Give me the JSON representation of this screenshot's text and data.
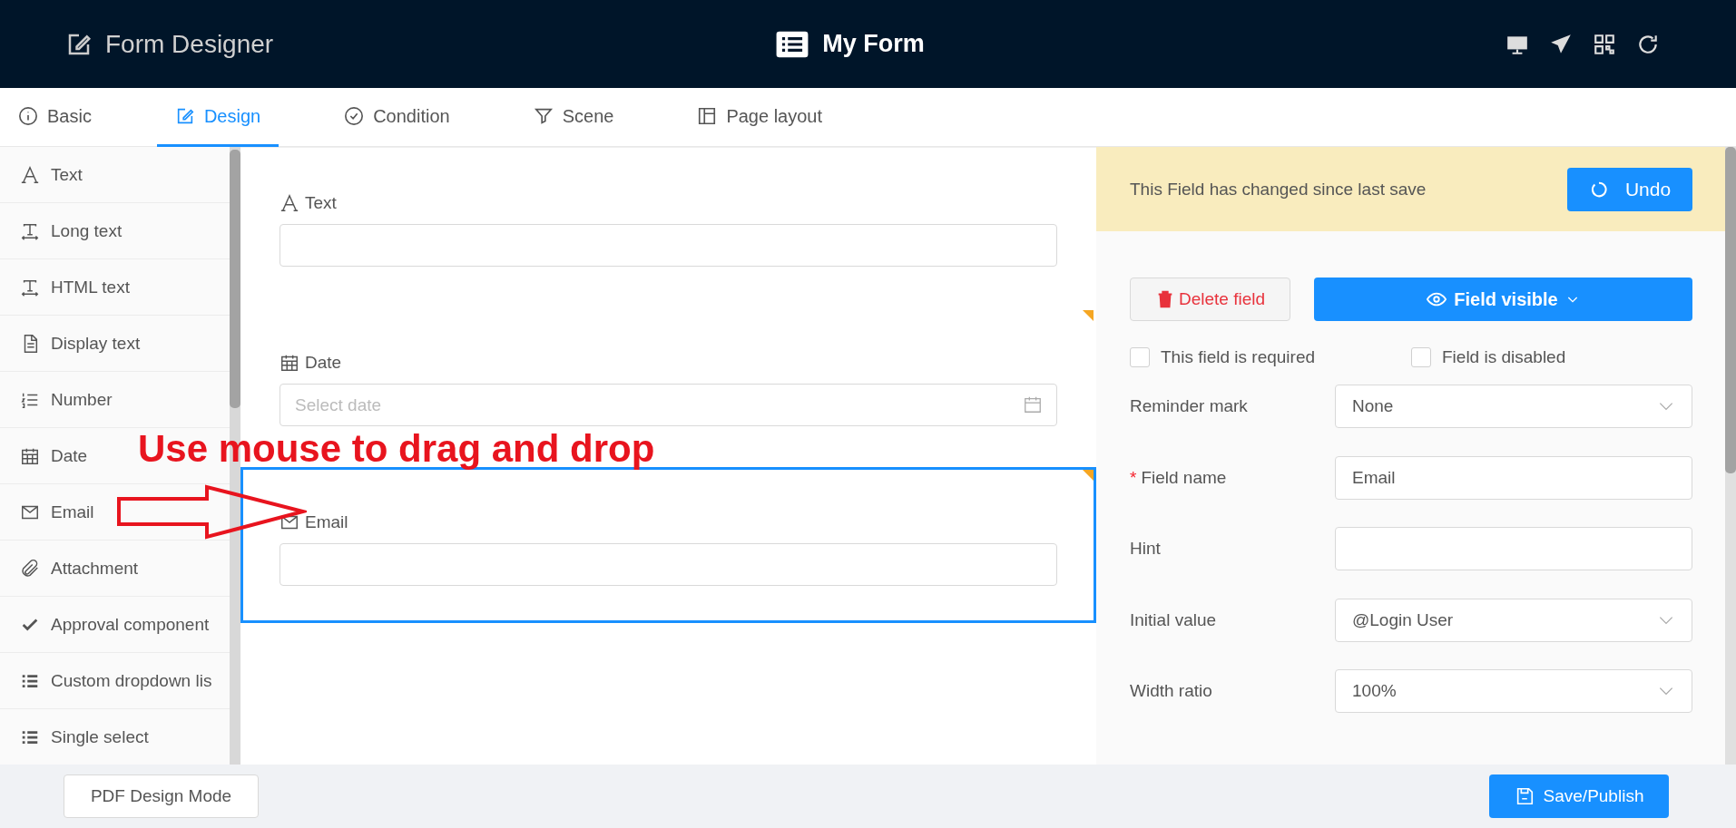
{
  "header": {
    "title": "Form Designer",
    "form_name": "My Form"
  },
  "tabs": [
    {
      "label": "Basic",
      "kind": "info",
      "selected": false
    },
    {
      "label": "Design",
      "kind": "edit",
      "selected": true
    },
    {
      "label": "Condition",
      "kind": "condition",
      "selected": false
    },
    {
      "label": "Scene",
      "kind": "scene",
      "selected": false
    },
    {
      "label": "Page layout",
      "kind": "layout",
      "selected": false
    }
  ],
  "palette": [
    {
      "label": "Text",
      "kind": "text"
    },
    {
      "label": "Long text",
      "kind": "long_text"
    },
    {
      "label": "HTML text",
      "kind": "html_text"
    },
    {
      "label": "Display text",
      "kind": "display_text"
    },
    {
      "label": "Number",
      "kind": "number"
    },
    {
      "label": "Date",
      "kind": "date"
    },
    {
      "label": "Email",
      "kind": "email"
    },
    {
      "label": "Attachment",
      "kind": "attachment"
    },
    {
      "label": "Approval component",
      "kind": "approval"
    },
    {
      "label": "Custom dropdown lis",
      "kind": "dropdown"
    },
    {
      "label": "Single select",
      "kind": "select"
    }
  ],
  "canvas": {
    "fields": [
      {
        "label": "Text",
        "kind": "text",
        "selected": false,
        "changed": false
      },
      {
        "label": "Date",
        "kind": "date",
        "placeholder": "Select date",
        "selected": false,
        "changed": true
      },
      {
        "label": "Email",
        "kind": "email",
        "selected": true,
        "changed": true
      }
    ]
  },
  "annotation": {
    "text": "Use mouse to drag and drop"
  },
  "properties": {
    "required_mark": "*",
    "notice": "This Field has changed since last save",
    "undo_button": "Undo",
    "delete_button": "Delete field",
    "visibility_button": "Field visible",
    "checkboxes": [
      {
        "label": "This field is required",
        "checked": false
      },
      {
        "label": "Field is disabled",
        "checked": false
      }
    ],
    "rows": [
      {
        "label": "Reminder mark",
        "kind": "select",
        "value": "None",
        "required": false
      },
      {
        "label": "Field name",
        "kind": "input",
        "value": "Email",
        "required": true
      },
      {
        "label": "Hint",
        "kind": "input",
        "required": false
      },
      {
        "label": "Initial value",
        "kind": "select",
        "value": "@Login User",
        "required": false
      },
      {
        "label": "Width ratio",
        "kind": "select",
        "value": "100%",
        "required": false
      }
    ]
  },
  "footer": {
    "pdf_button": "PDF Design Mode",
    "save_button": "Save/Publish"
  }
}
